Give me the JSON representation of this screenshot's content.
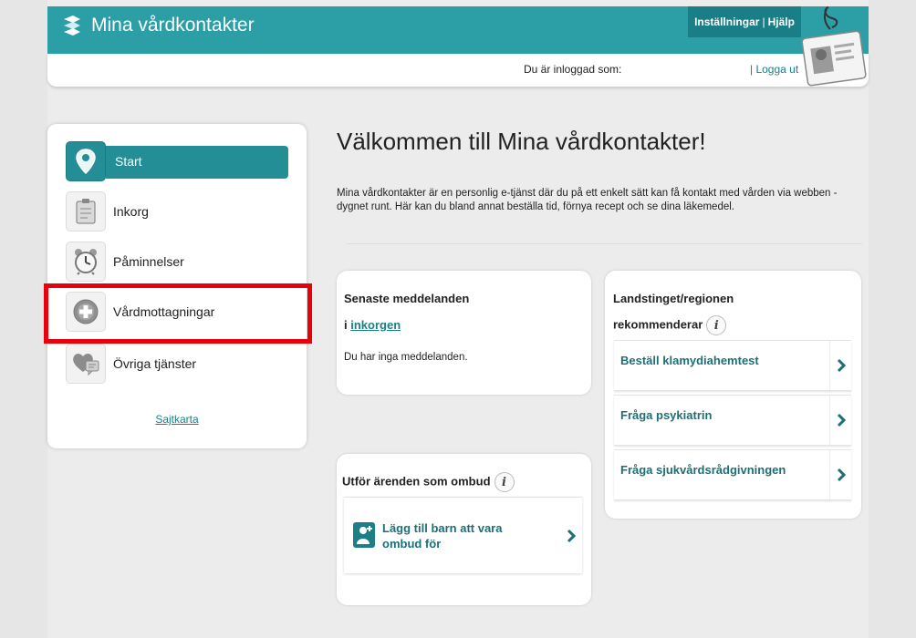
{
  "header": {
    "app_title": "Mina vårdkontakter",
    "settings_label": "Inställningar",
    "separator": "|",
    "help_label": "Hjälp",
    "logged_in_label": "Du är inloggad som:",
    "logout_label": "| Logga ut",
    "brand_color": "#2b9fa5"
  },
  "sidebar": {
    "items": [
      {
        "label": "Start",
        "icon": "location-pin-icon",
        "active": true
      },
      {
        "label": "Inkorg",
        "icon": "clipboard-icon",
        "active": false
      },
      {
        "label": "Påminnelser",
        "icon": "alarm-clock-icon",
        "active": false
      },
      {
        "label": "Vårdmottagningar",
        "icon": "plus-circle-icon",
        "active": false
      },
      {
        "label": "Övriga tjänster",
        "icon": "heart-speech-icon",
        "active": false
      }
    ],
    "sitemap_label": "Sajtkarta",
    "highlight_color": "#e8000b"
  },
  "main": {
    "title": "Välkommen till Mina vårdkontakter!",
    "intro_text": "Mina vårdkontakter är en personlig e-tjänst där du på ett enkelt sätt kan få kontakt med vården via webben - dygnet runt. Här kan du bland annat beställa tid, förnya recept och se dina läkemedel.",
    "messages": {
      "heading": "Senaste meddelanden",
      "inbox_prefix": "i",
      "inbox_link": "inkorgen",
      "empty_text": "Du har inga meddelanden."
    },
    "ombud": {
      "heading": "Utför ärenden som ombud",
      "info": "i",
      "add_child_link": "Lägg till barn att vara ombud för"
    },
    "recommend": {
      "heading_line1": "Landstinget/regionen",
      "heading_line2": "rekommenderar",
      "info": "i",
      "links": [
        "Beställ klamydiahemtest",
        "Fråga psykiatrin",
        "Fråga sjukvårdsrådgivningen"
      ]
    }
  }
}
